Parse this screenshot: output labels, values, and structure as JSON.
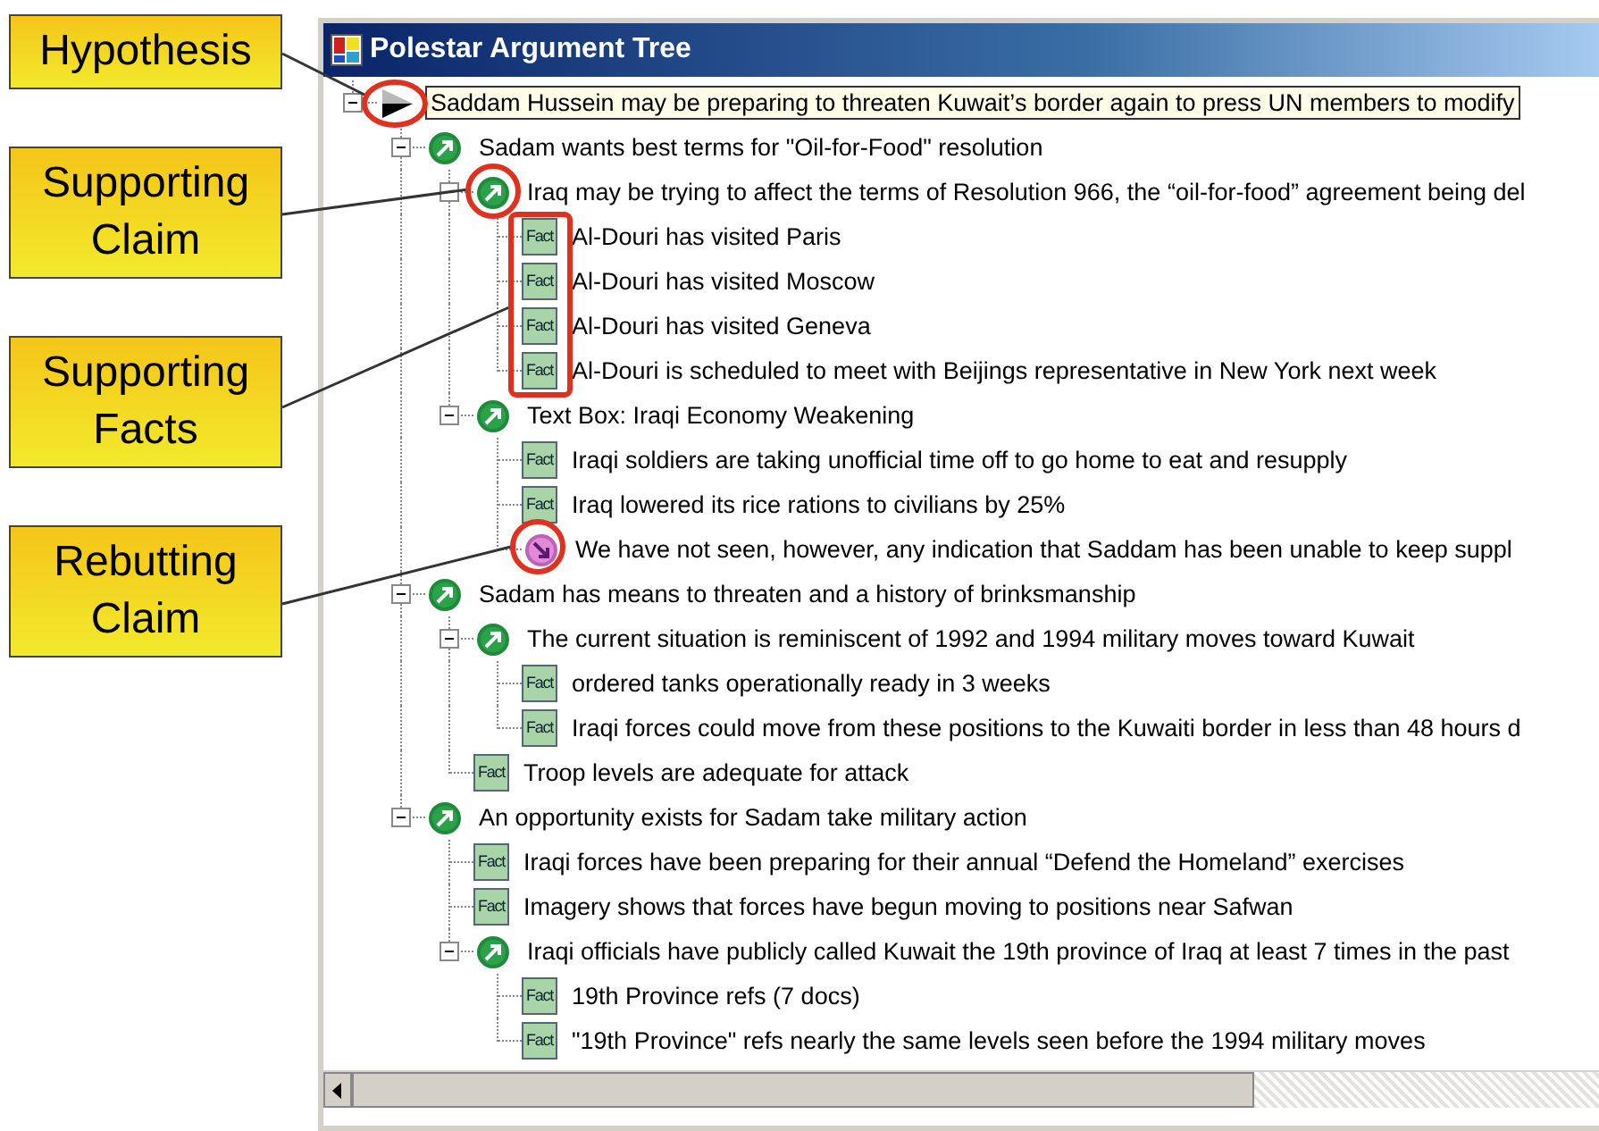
{
  "callouts": [
    {
      "label": "Hypothesis"
    },
    {
      "label": "Supporting Claim"
    },
    {
      "label": "Supporting Facts"
    },
    {
      "label": "Rebutting Claim"
    }
  ],
  "window": {
    "title": "Polestar Argument Tree"
  },
  "tree": [
    {
      "kind": "hypothesis",
      "text": "Saddam Hussein may be preparing to threaten Kuwait’s border again to press UN members to modify",
      "selected": true,
      "expanded": true,
      "children": [
        {
          "kind": "support",
          "text": "Sadam wants best terms for \"Oil-for-Food\" resolution",
          "selected": false,
          "expanded": true,
          "children": [
            {
              "kind": "support",
              "text": "Iraq may be trying to affect the terms of Resolution 966, the “oil-for-food” agreement being del",
              "selected": false,
              "expanded": true,
              "children": [
                {
                  "kind": "fact",
                  "badge": "Fact",
                  "text": "Al-Douri has visited Paris",
                  "selected": false
                },
                {
                  "kind": "fact",
                  "badge": "Fact",
                  "text": "Al-Douri has visited Moscow",
                  "selected": false
                },
                {
                  "kind": "fact",
                  "badge": "Fact",
                  "text": "Al-Douri has visited Geneva",
                  "selected": false
                },
                {
                  "kind": "fact",
                  "badge": "Fact",
                  "text": "Al-Douri is scheduled to meet with Beijings representative in New York next week",
                  "selected": false
                }
              ]
            },
            {
              "kind": "support",
              "text": "Text Box: Iraqi Economy Weakening",
              "selected": false,
              "expanded": true,
              "children": [
                {
                  "kind": "fact",
                  "badge": "Fact",
                  "text": "Iraqi soldiers are taking unofficial time off to go home to eat and resupply",
                  "selected": false
                },
                {
                  "kind": "fact",
                  "badge": "Fact",
                  "text": "Iraq lowered its rice rations to civilians by 25%",
                  "selected": false
                },
                {
                  "kind": "rebuttal",
                  "text": "We have not seen, however, any indication that Saddam has been unable to keep suppl",
                  "selected": false
                }
              ]
            }
          ]
        },
        {
          "kind": "support",
          "text": "Sadam has means to threaten and a history of brinksmanship",
          "selected": false,
          "expanded": true,
          "children": [
            {
              "kind": "support",
              "text": "The current situation is reminiscent of 1992 and 1994 military moves toward Kuwait",
              "selected": false,
              "expanded": true,
              "children": [
                {
                  "kind": "fact",
                  "badge": "Fact",
                  "text": "ordered tanks operationally ready in 3 weeks",
                  "selected": false
                },
                {
                  "kind": "fact",
                  "badge": "Fact",
                  "text": "Iraqi forces could move from these positions to the Kuwaiti border in less than 48 hours d",
                  "selected": false
                }
              ]
            },
            {
              "kind": "fact",
              "badge": "Fact",
              "text": "Troop levels are adequate for attack",
              "selected": false
            }
          ]
        },
        {
          "kind": "support",
          "text": "An opportunity exists for Sadam take military action",
          "selected": false,
          "expanded": true,
          "children": [
            {
              "kind": "fact",
              "badge": "Fact",
              "text": "Iraqi forces have been preparing for their annual “Defend the Homeland” exercises",
              "selected": false
            },
            {
              "kind": "fact",
              "badge": "Fact",
              "text": "Imagery shows that forces have begun moving to positions near Safwan",
              "selected": false
            },
            {
              "kind": "support",
              "text": "Iraqi officials have publicly called Kuwait the 19th province of Iraq at least 7 times in the past",
              "selected": false,
              "expanded": true,
              "children": [
                {
                  "kind": "fact",
                  "badge": "Fact",
                  "text": "19th Province refs (7 docs)",
                  "selected": false
                },
                {
                  "kind": "fact",
                  "badge": "Fact",
                  "text": "\"19th Province\" refs nearly the same levels seen before the 1994 military moves",
                  "selected": false
                }
              ]
            }
          ]
        }
      ]
    }
  ]
}
